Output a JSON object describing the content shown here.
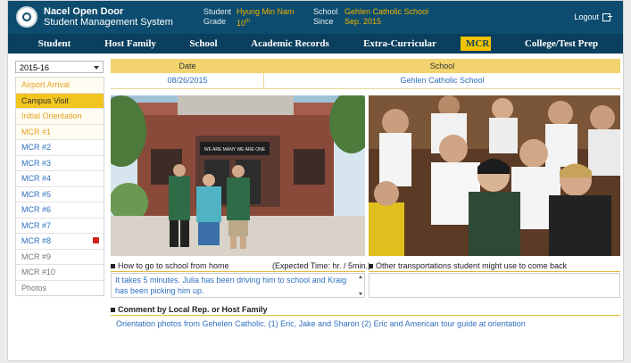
{
  "header": {
    "brand_title": "Nacel Open Door",
    "brand_sub": "Student Management System",
    "student_label": "Student",
    "student_value": "Hyung Min Nam",
    "grade_label": "Grade",
    "grade_value": "10",
    "grade_sup": "th",
    "school_label": "School",
    "school_value": "Gehlen Catholic School",
    "since_label": "Since",
    "since_value": "Sep. 2015",
    "logout": "Logout",
    "colors": {
      "topbar": "#0d4c6e",
      "accent": "#f2c400"
    }
  },
  "nav": [
    {
      "label": "Student"
    },
    {
      "label": "Host Family"
    },
    {
      "label": "School"
    },
    {
      "label": "Academic Records"
    },
    {
      "label": "Extra-Curricular"
    },
    {
      "label": "MCR",
      "active": true
    },
    {
      "label": "College/Test Prep"
    }
  ],
  "year_select": {
    "value": "2015-16"
  },
  "sidebar": [
    {
      "label": "Airport Arrival",
      "style": "orange"
    },
    {
      "label": "Campus Visit",
      "style": "selected"
    },
    {
      "label": "Initial Orientation",
      "style": "orange"
    },
    {
      "label": "MCR #1",
      "style": "orange"
    },
    {
      "label": "MCR #2",
      "style": "blue"
    },
    {
      "label": "MCR #3",
      "style": "blue"
    },
    {
      "label": "MCR #4",
      "style": "blue"
    },
    {
      "label": "MCR #5",
      "style": "blue"
    },
    {
      "label": "MCR #6",
      "style": "blue"
    },
    {
      "label": "MCR #7",
      "style": "blue"
    },
    {
      "label": "MCR #8",
      "style": "blue",
      "badge": true
    },
    {
      "label": "MCR #9",
      "style": "gray"
    },
    {
      "label": "MCR #10",
      "style": "gray"
    },
    {
      "label": "Photos",
      "style": "gray"
    }
  ],
  "table": {
    "col_date": "Date",
    "col_school": "School",
    "date": "08/26/2015",
    "school": "Gehlen Catholic School"
  },
  "photos": [
    {
      "name": "school-entrance-photo",
      "sign_text": "WE ARE MANY WE ARE ONE"
    },
    {
      "name": "students-group-photo"
    }
  ],
  "howto": {
    "title": "How to go to school from home",
    "hint": "(Expected Time: hr. / 5min.)",
    "text": "It takes 5 minutes. Julia has been driving him to school and Kraig has been picking him up."
  },
  "other_transport": {
    "title": "Other transportations student might use to come back",
    "text": ""
  },
  "comment": {
    "title": "Comment by Local Rep. or Host Family",
    "text": "Orientation photos from Gehelen Catholic. (1) Eric, Jake and Sharon (2) Eric and American tour guide at orientation"
  }
}
